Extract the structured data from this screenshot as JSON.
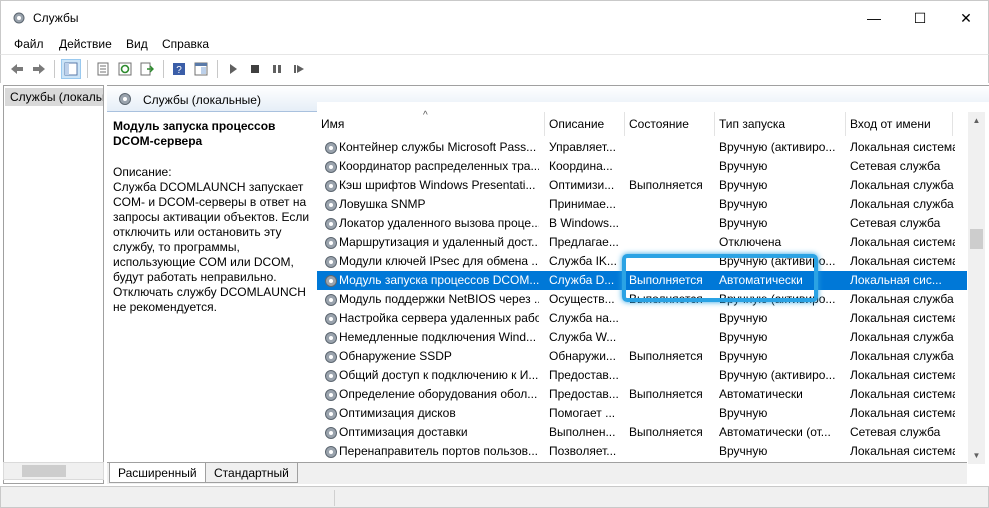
{
  "window": {
    "title": "Службы",
    "minimize_glyph": "—",
    "maximize_glyph": "☐",
    "close_glyph": "✕"
  },
  "menu": [
    "Файл",
    "Действие",
    "Вид",
    "Справка"
  ],
  "tree": {
    "root_label": "Службы (локальные)"
  },
  "pane": {
    "header": "Службы (локальные)",
    "selected_title": "Модуль запуска процессов DCOM-сервера",
    "description_label": "Описание:",
    "description_text": "Служба DCOMLAUNCH запускает COM- и DCOM-серверы в ответ на запросы активации объектов. Если отключить или остановить эту службу, то программы, использующие COM или DCOM, будут работать неправильно. Отключать службу DCOMLAUNCH не рекомендуется."
  },
  "columns": [
    "Имя",
    "Описание",
    "Состояние",
    "Тип запуска",
    "Вход от имени"
  ],
  "rows": [
    {
      "name": "Контейнер службы Microsoft Pass...",
      "desc": "Управляет...",
      "state": "",
      "startup": "Вручную (активиро...",
      "logon": "Локальная система"
    },
    {
      "name": "Координатор распределенных тра...",
      "desc": "Координа...",
      "state": "",
      "startup": "Вручную",
      "logon": "Сетевая служба"
    },
    {
      "name": "Кэш шрифтов Windows Presentati...",
      "desc": "Оптимизи...",
      "state": "Выполняется",
      "startup": "Вручную",
      "logon": "Локальная служба"
    },
    {
      "name": "Ловушка SNMP",
      "desc": "Принимае...",
      "state": "",
      "startup": "Вручную",
      "logon": "Локальная служба"
    },
    {
      "name": "Локатор удаленного вызова проце...",
      "desc": "В Windows...",
      "state": "",
      "startup": "Вручную",
      "logon": "Сетевая служба"
    },
    {
      "name": "Маршрутизация и удаленный дост...",
      "desc": "Предлагае...",
      "state": "",
      "startup": "Отключена",
      "logon": "Локальная система"
    },
    {
      "name": "Модули ключей IPsec для обмена ...",
      "desc": "Служба IK...",
      "state": "",
      "startup": "Вручную (активиро...",
      "logon": "Локальная система"
    },
    {
      "name": "Модуль запуска процессов DCOM...",
      "desc": "Служба D...",
      "state": "Выполняется",
      "startup": "Автоматически",
      "logon": "Локальная сис...",
      "selected": true
    },
    {
      "name": "Модуль поддержки NetBIOS через ...",
      "desc": "Осуществ...",
      "state": "Выполняется",
      "startup": "Вручную (активиро...",
      "logon": "Локальная служба"
    },
    {
      "name": "Настройка сервера удаленных рабо...",
      "desc": "Служба на...",
      "state": "",
      "startup": "Вручную",
      "logon": "Локальная система"
    },
    {
      "name": "Немедленные подключения Wind...",
      "desc": "Служба W...",
      "state": "",
      "startup": "Вручную",
      "logon": "Локальная служба"
    },
    {
      "name": "Обнаружение SSDP",
      "desc": "Обнаружи...",
      "state": "Выполняется",
      "startup": "Вручную",
      "logon": "Локальная служба"
    },
    {
      "name": "Общий доступ к подключению к И...",
      "desc": "Предостав...",
      "state": "",
      "startup": "Вручную (активиро...",
      "logon": "Локальная система"
    },
    {
      "name": "Определение оборудования обол...",
      "desc": "Предостав...",
      "state": "Выполняется",
      "startup": "Автоматически",
      "logon": "Локальная система"
    },
    {
      "name": "Оптимизация дисков",
      "desc": "Помогает ...",
      "state": "",
      "startup": "Вручную",
      "logon": "Локальная система"
    },
    {
      "name": "Оптимизация доставки",
      "desc": "Выполнен...",
      "state": "Выполняется",
      "startup": "Автоматически (от...",
      "logon": "Сетевая служба"
    },
    {
      "name": "Перенаправитель портов пользов...",
      "desc": "Позволяет...",
      "state": "",
      "startup": "Вручную",
      "logon": "Локальная система"
    }
  ],
  "tabs": [
    "Расширенный",
    "Стандартный"
  ],
  "colors": {
    "selection": "#0078d7",
    "highlight": "#2ba3e4"
  }
}
